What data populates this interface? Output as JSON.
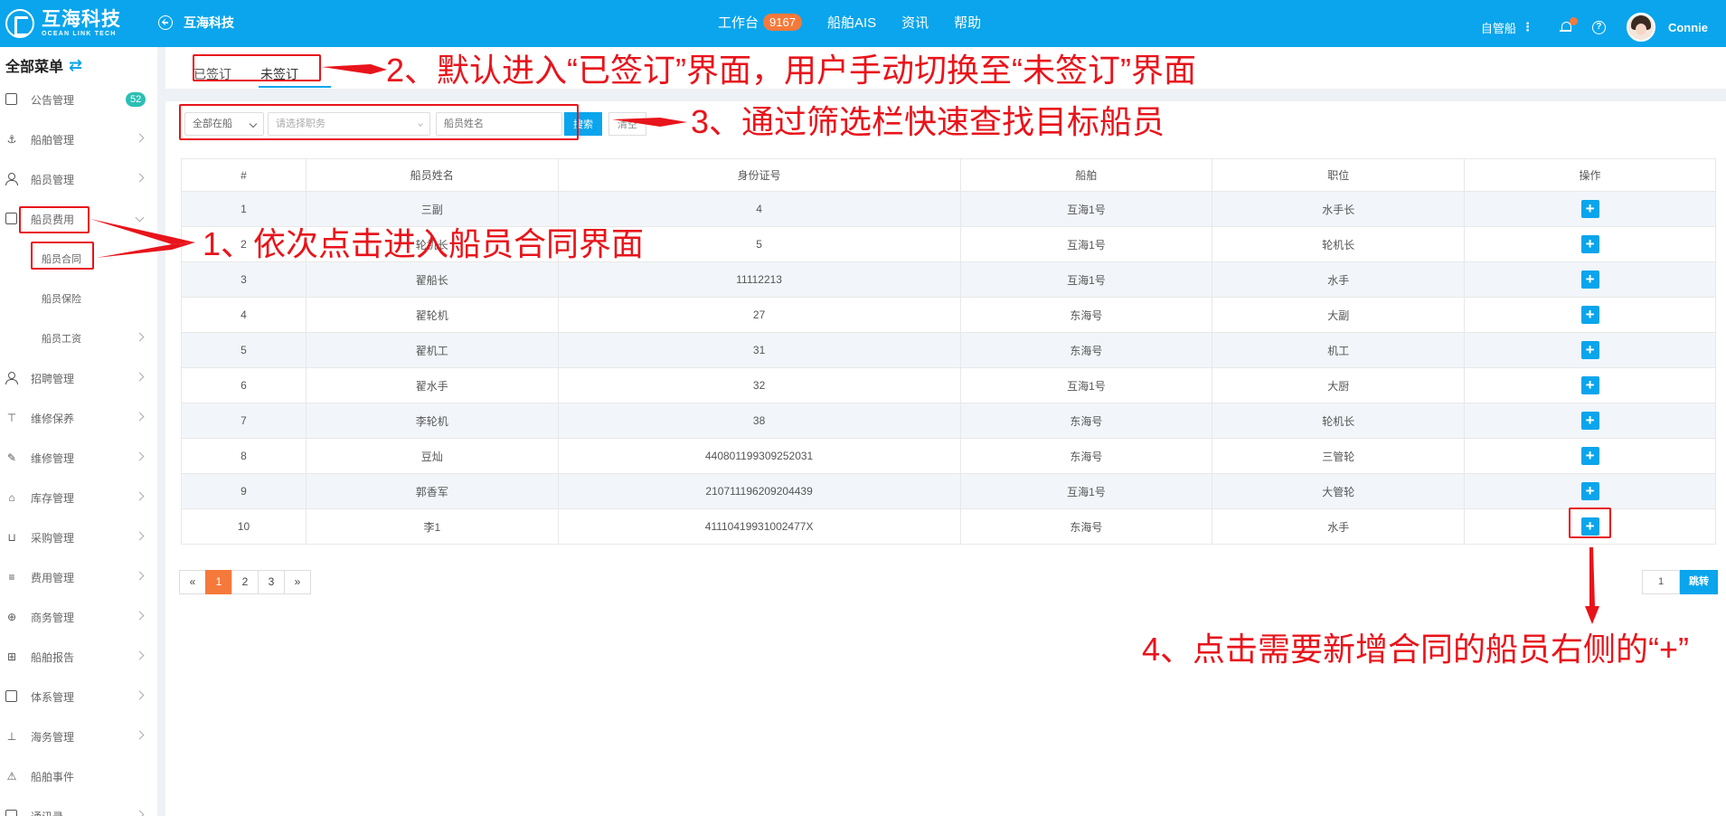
{
  "header": {
    "logo_cn": "互海科技",
    "logo_en": "OCEAN LINK TECH",
    "back_label": "互海科技",
    "nav": [
      {
        "label": "工作台",
        "badge": "9167"
      },
      {
        "label": "船舶AIS"
      },
      {
        "label": "资讯"
      },
      {
        "label": "帮助"
      }
    ],
    "ship_selector": "自管船",
    "help_glyph": "?",
    "user": "Connie"
  },
  "sidebar": {
    "title": "全部菜单",
    "items": [
      {
        "label": "公告管理",
        "badge": "52"
      },
      {
        "label": "船舶管理"
      },
      {
        "label": "船员管理"
      },
      {
        "label": "船员费用"
      },
      {
        "label": "船员合同"
      },
      {
        "label": "船员保险"
      },
      {
        "label": "船员工资"
      },
      {
        "label": "招聘管理"
      },
      {
        "label": "维修保养"
      },
      {
        "label": "维修管理"
      },
      {
        "label": "库存管理"
      },
      {
        "label": "采购管理"
      },
      {
        "label": "费用管理"
      },
      {
        "label": "商务管理"
      },
      {
        "label": "船舶报告"
      },
      {
        "label": "体系管理"
      },
      {
        "label": "海务管理"
      },
      {
        "label": "船舶事件"
      },
      {
        "label": "通讯录"
      }
    ]
  },
  "tabs": [
    "已签订",
    "未签订"
  ],
  "filter": {
    "ship_select": "全部在船",
    "duty_placeholder": "请选择职务",
    "name_placeholder": "船员姓名",
    "search_label": "搜索",
    "clear_label": "清空"
  },
  "table": {
    "headers": [
      "#",
      "船员姓名",
      "身份证号",
      "船舶",
      "职位",
      "操作"
    ],
    "rows": [
      [
        "1",
        "三副",
        "4",
        "互海1号",
        "水手长"
      ],
      [
        "2",
        "轮机长",
        "5",
        "互海1号",
        "轮机长"
      ],
      [
        "3",
        "翟船长",
        "11112213",
        "互海1号",
        "水手"
      ],
      [
        "4",
        "翟轮机",
        "27",
        "东海号",
        "大副"
      ],
      [
        "5",
        "翟机工",
        "31",
        "东海号",
        "机工"
      ],
      [
        "6",
        "翟水手",
        "32",
        "互海1号",
        "大厨"
      ],
      [
        "7",
        "李轮机",
        "38",
        "东海号",
        "轮机长"
      ],
      [
        "8",
        "豆灿",
        "440801199309252031",
        "东海号",
        "三管轮"
      ],
      [
        "9",
        "郭香军",
        "210711196209204439",
        "互海1号",
        "大管轮"
      ],
      [
        "10",
        "李1",
        "41110419931002477X",
        "东海号",
        "水手"
      ]
    ],
    "action_glyph": "+"
  },
  "pagination": {
    "prev": "«",
    "pages": [
      "1",
      "2",
      "3"
    ],
    "next": "»",
    "jump_value": "1",
    "jump_label": "跳转"
  },
  "annotations": {
    "step1": "1、依次点击进入船员合同界面",
    "step2": "2、默认进入“已签订”界面，用户手动切换至“未签订”界面",
    "step3": "3、通过筛选栏快速查找目标船员",
    "step4": "4、点击需要新增合同的船员右侧的“+”",
    "color": "#e8141b"
  },
  "colors": {
    "header": "#0aa5ec",
    "accent": "#0aa5ec",
    "badge_orange": "#f5793b",
    "badge_teal": "#2bbfb4"
  }
}
